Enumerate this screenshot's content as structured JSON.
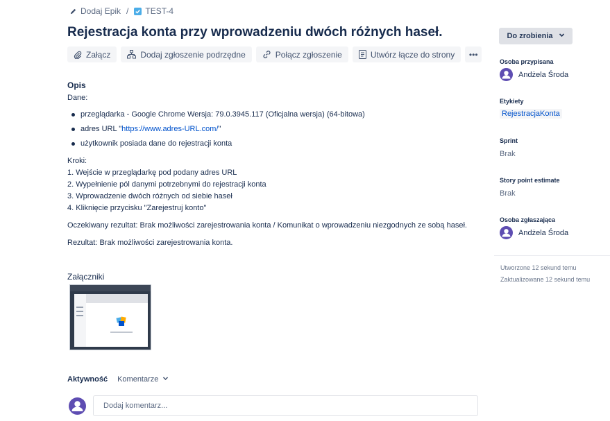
{
  "breadcrumb": {
    "epic_label": "Dodaj Epik",
    "separator": "/",
    "issue_key": "TEST-4"
  },
  "issue": {
    "title": "Rejestracja konta przy wprowadzeniu dwóch różnych haseł."
  },
  "toolbar": {
    "attach": "Załącz",
    "add_child": "Dodaj zgłoszenie podrzędne",
    "link_issue": "Połącz zgłoszenie",
    "create_page_link": "Utwórz łącze do strony",
    "more": "•••"
  },
  "description": {
    "heading": "Opis",
    "intro": "Dane:",
    "items": [
      {
        "text": "przeglądarka - Google Chrome Wersja: 79.0.3945.117 (Oficjalna wersja) (64-bitowa)"
      },
      {
        "prefix": "adres URL \"",
        "link": "https://www.adres-URL.com/",
        "suffix": "\""
      },
      {
        "text": "użytkownik posiada dane do rejestracji konta"
      }
    ],
    "steps_heading": "Kroki:",
    "steps": [
      "1. Wejście w przeglądarkę pod podany adres URL",
      "2. Wypełnienie pól danymi potrzebnymi do rejestracji konta",
      "3. Wprowadzenie dwóch różnych od siebie haseł",
      "4. Kliknięcie przycisku \"Zarejestruj konto\""
    ],
    "expected": "Oczekiwany rezultat: Brak możliwości zarejestrowania konta / Komunikat o wprowadzeniu niezgodnych ze sobą haseł.",
    "result": "Rezultat: Brak możliwości zarejestrowania konta."
  },
  "attachments": {
    "heading": "Załączniki"
  },
  "activity": {
    "heading": "Aktywność",
    "filter": "Komentarze",
    "comment_placeholder": "Dodaj komentarz..."
  },
  "sidebar": {
    "status": "Do zrobienia",
    "assignee_label": "Osoba przypisana",
    "assignee": "Andżela Środa",
    "labels_label": "Etykiety",
    "label_value": "RejestracjaKonta",
    "sprint_label": "Sprint",
    "sprint_value": "Brak",
    "story_points_label": "Story point estimate",
    "story_points_value": "Brak",
    "reporter_label": "Osoba zgłaszająca",
    "reporter": "Andżela Środa",
    "created": "Utworzone 12 sekund temu",
    "updated": "Zaktualizowane 12 sekund temu"
  },
  "colors": {
    "accent": "#0052cc",
    "avatar": "#5e4db2",
    "issue_type": "#4bade8"
  }
}
